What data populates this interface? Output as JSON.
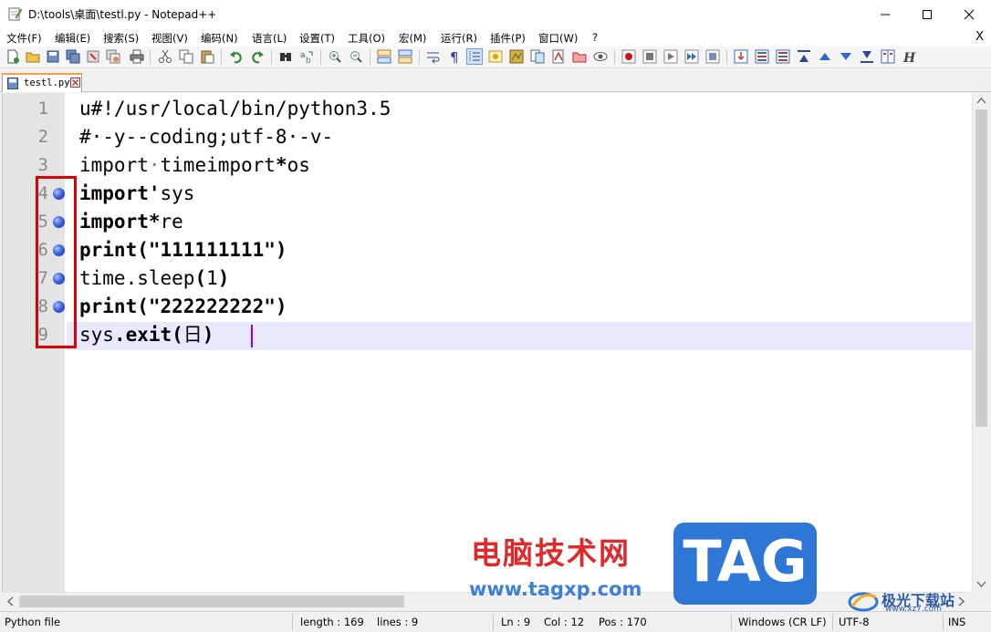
{
  "window": {
    "title": "D:\\tools\\桌面\\testl.py - Notepad++",
    "minimize_glyph": "—",
    "maximize_glyph": "☐",
    "close_glyph": "✕"
  },
  "menu": {
    "items": [
      "文件(F)",
      "编辑(E)",
      "搜索(S)",
      "视图(V)",
      "编码(N)",
      "语言(L)",
      "设置(T)",
      "工具(O)",
      "宏(M)",
      "运行(R)",
      "插件(P)",
      "窗口(W)",
      "?"
    ],
    "close_doc_glyph": "X"
  },
  "tab": {
    "label": "testl.py"
  },
  "editor": {
    "line_numbers": [
      "1",
      "2",
      "3",
      "4",
      "5",
      "6",
      "7",
      "8",
      "9"
    ],
    "bookmarked_lines": [
      4,
      5,
      6,
      7,
      8
    ],
    "current_line": 9,
    "lines": [
      [
        {
          "t": "u#!/usr/local/bin/python3.5",
          "c": "plain"
        }
      ],
      [
        {
          "t": "#·-y--coding;utf-8·-v-",
          "c": "plain"
        }
      ],
      [
        {
          "t": "import",
          "c": "plain"
        },
        {
          "t": "·",
          "c": "ws"
        },
        {
          "t": "timeimport",
          "c": "plain"
        },
        {
          "t": "*",
          "c": "kw"
        },
        {
          "t": "os",
          "c": "plain"
        }
      ],
      [
        {
          "t": "import'",
          "c": "kw"
        },
        {
          "t": "sys",
          "c": "plain"
        }
      ],
      [
        {
          "t": "import*",
          "c": "kw"
        },
        {
          "t": "re",
          "c": "plain"
        }
      ],
      [
        {
          "t": "print(\"111111111\")",
          "c": "kw"
        }
      ],
      [
        {
          "t": "time.sleep",
          "c": "plain"
        },
        {
          "t": "(",
          "c": "kw"
        },
        {
          "t": "1",
          "c": "plain"
        },
        {
          "t": ")",
          "c": "kw"
        }
      ],
      [
        {
          "t": "print(\"222222222\")",
          "c": "kw"
        }
      ],
      [
        {
          "t": "sys",
          "c": "plain"
        },
        {
          "t": ".exit(",
          "c": "kw"
        },
        {
          "t": "日",
          "c": "plain"
        },
        {
          "t": ")",
          "c": "kw"
        }
      ]
    ]
  },
  "status": {
    "file_type": "Python file",
    "length": "length : 169",
    "lines": "lines : 9",
    "ln": "Ln : 9",
    "col": "Col : 12",
    "pos": "Pos : 170",
    "eol": "Windows (CR LF)",
    "encoding": "UTF-8",
    "mode": "INS"
  },
  "watermark": {
    "site_cn": "电脑技术网",
    "site_url": "www.tagxp.com",
    "tag": "TAG",
    "corner_cn": "极光下载站",
    "corner_url": "www.xz7.com"
  },
  "colors": {
    "bookmark": "#3d63e0",
    "current_line_bg": "#e8e8ff",
    "caret": "#8000ff",
    "highlight_box": "#e00000",
    "tab_accent": "#f5a142"
  }
}
